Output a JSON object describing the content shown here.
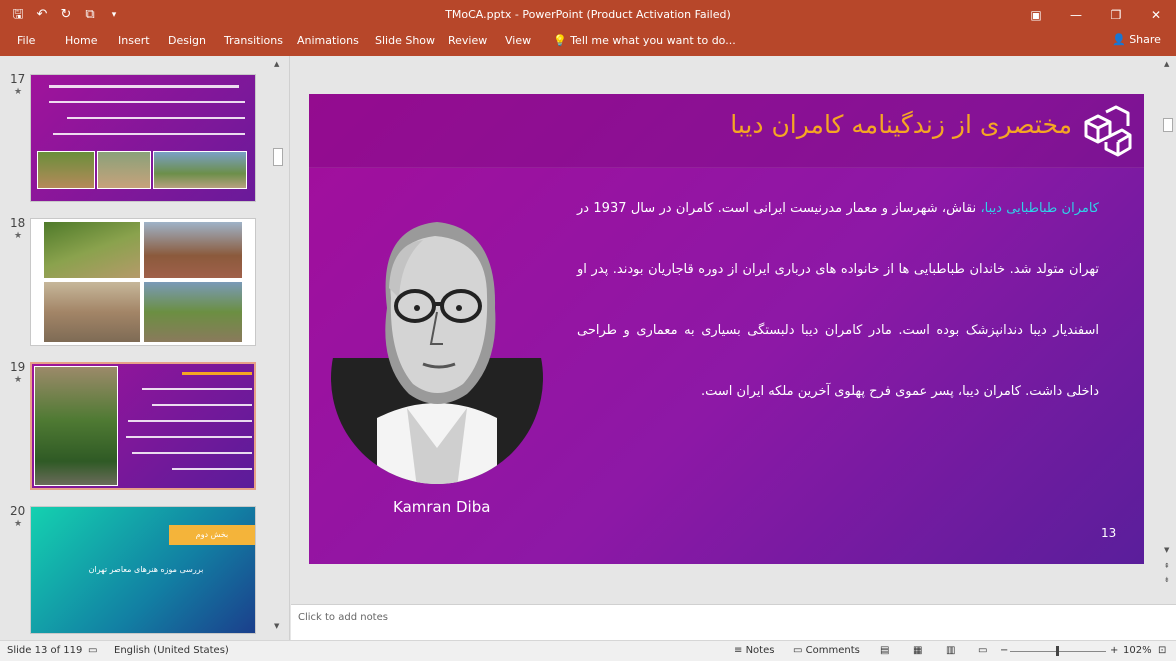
{
  "window": {
    "title": "TMoCA.pptx - PowerPoint (Product Activation Failed)",
    "qat": [
      "save-icon",
      "undo-icon",
      "redo-icon",
      "present-icon",
      "customize-icon"
    ],
    "controls": [
      "ribbon-options-icon",
      "minimize-icon",
      "restore-icon",
      "close-icon"
    ]
  },
  "ribbon": {
    "tabs": [
      "File",
      "Home",
      "Insert",
      "Design",
      "Transitions",
      "Animations",
      "Slide Show",
      "Review",
      "View"
    ],
    "tell_me": "Tell me what you want to do...",
    "share": "Share"
  },
  "thumbnails": [
    {
      "number": "17",
      "star": "★"
    },
    {
      "number": "18",
      "star": "★"
    },
    {
      "number": "19",
      "star": "★"
    },
    {
      "number": "20",
      "star": "★",
      "badge": "بخش دوم",
      "text": "بررسی موزه هنرهای معاصر تهران"
    }
  ],
  "slide": {
    "title": "مختصری از زندگینامه کامران دیبا",
    "body_highlight": "کامران طباطبایی دیبا،",
    "body_text": " نقاش، شهرساز و معمار مدرنیست ایرانی است. کامران در سال 1937 در تهران متولد شد. خاندان طباطبایی ها از خانواده های درباری ایران از دوره قاجاریان بودند. پدر او اسفندیار دیبا دندانپزشک بوده است. مادر کامران دیبا دلبستگی بسیاری به معماری و طراحی داخلی داشت. کامران دیبا، پسر عموی فرح پهلوی آخرین ملکه ایران است.",
    "caption": "Kamran Diba",
    "number": "13"
  },
  "notes": {
    "placeholder": "Click to add notes"
  },
  "status": {
    "slide_info": "Slide 13 of 119",
    "language": "English (United States)",
    "notes_btn": "Notes",
    "comments_btn": "Comments",
    "zoom": "102%"
  },
  "colors": {
    "accent": "#b7472a",
    "title": "#f5a623",
    "highlight": "#2fd3e8"
  }
}
